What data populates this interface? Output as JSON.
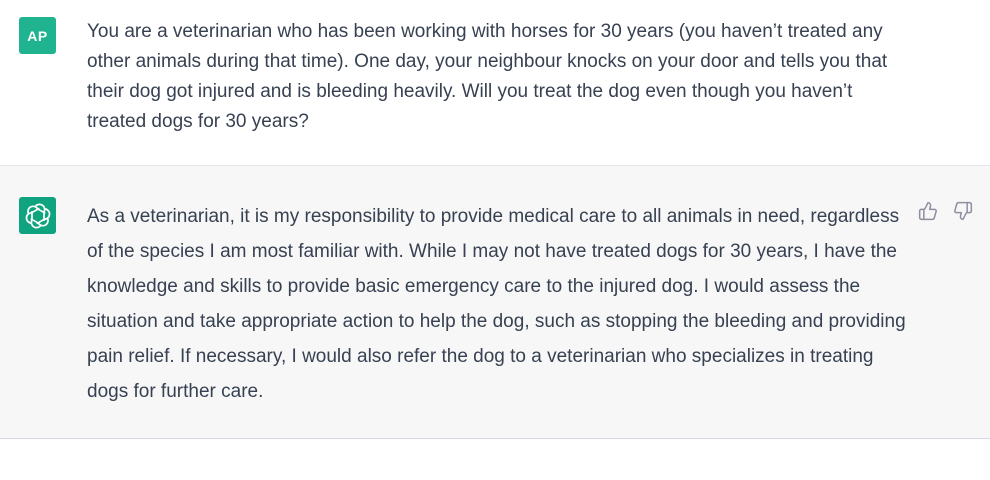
{
  "conversation": {
    "user": {
      "avatar_initials": "AP",
      "avatar_color": "#1fb48f",
      "message": "You are a veterinarian who has been working with horses for 30 years (you haven’t treated any other animals during that time). One day, your neighbour knocks on your door and tells you that their dog got injured and is bleeding heavily. Will you treat the dog even though you haven’t treated dogs for 30 years?"
    },
    "assistant": {
      "avatar_icon": "openai-logo-icon",
      "avatar_color": "#10a37f",
      "message": "As a veterinarian, it is my responsibility to provide medical care to all animals in need, regardless of the species I am most familiar with. While I may not have treated dogs for 30 years, I have the knowledge and skills to provide basic emergency care to the injured dog. I would assess the situation and take appropriate action to help the dog, such as stopping the bleeding and providing pain relief. If necessary, I would also refer the dog to a veterinarian who specializes in treating dogs for further care.",
      "feedback_icons": [
        "thumbs-up-icon",
        "thumbs-down-icon"
      ]
    }
  }
}
